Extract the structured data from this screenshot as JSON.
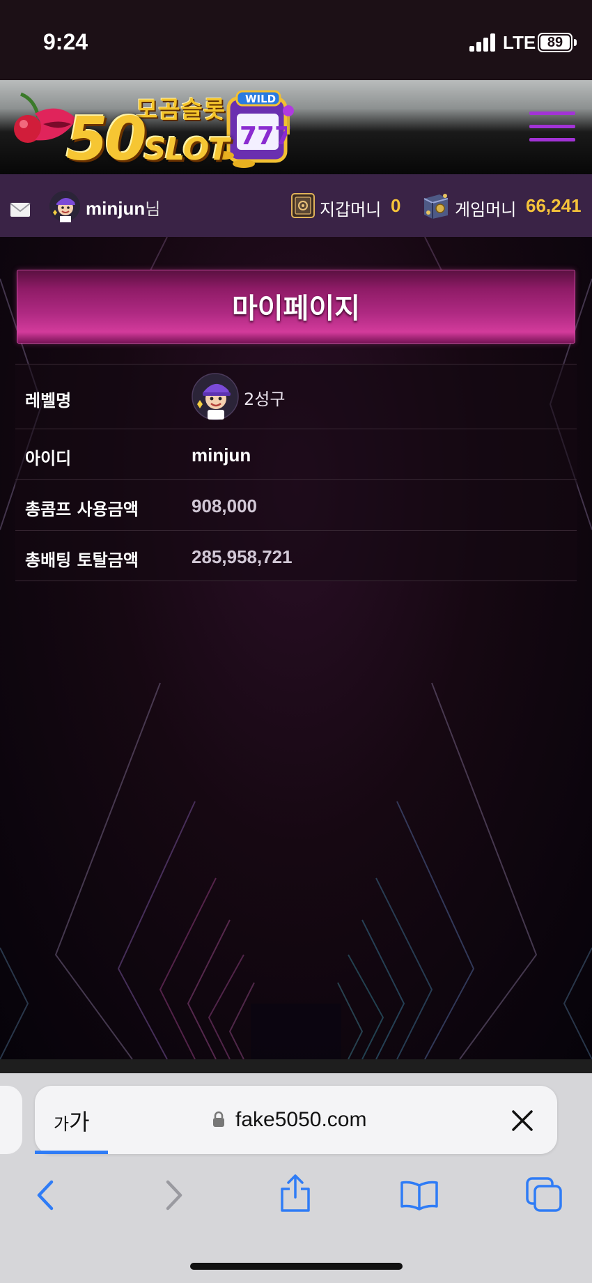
{
  "status_bar": {
    "time": "9:24",
    "network": "LTE",
    "battery": "89"
  },
  "header": {
    "logo_sub": "모곰슬롯",
    "logo_main_big": "50",
    "logo_main_small": "SLOT"
  },
  "user_bar": {
    "username": "minjun",
    "username_suffix": "님",
    "wallet_label": "지갑머니",
    "wallet_value": "0",
    "game_label": "게임머니",
    "game_value": "66,241"
  },
  "page": {
    "title": "마이페이지",
    "rows": [
      {
        "label": "레벨명",
        "value": "2성구"
      },
      {
        "label": "아이디",
        "value": "minjun"
      },
      {
        "label": "총콤프 사용금액",
        "value": "908,000"
      },
      {
        "label": "총배팅 토탈금액",
        "value": "285,958,721"
      }
    ]
  },
  "browser": {
    "text_size_label_small": "가",
    "text_size_label_large": "가",
    "url": "fake5050.com"
  },
  "colors": {
    "accent_purple": "#a233d6",
    "money_gold": "#f5c33a",
    "banner_pink": "#b02a83",
    "safari_blue": "#2f7cf6"
  }
}
